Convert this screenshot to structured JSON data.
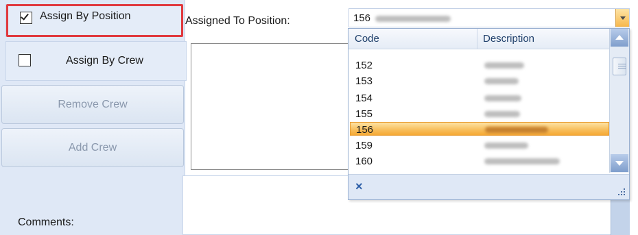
{
  "assign_by_position": {
    "label": "Assign By Position",
    "checked": true
  },
  "assign_by_crew": {
    "label": "Assign By Crew",
    "checked": false
  },
  "buttons": {
    "remove_crew": "Remove Crew",
    "add_crew": "Add Crew"
  },
  "assigned_to_position": {
    "label": "Assigned To Position:",
    "value": "156"
  },
  "comments": {
    "label": "Comments:"
  },
  "dropdown": {
    "columns": [
      "Code",
      "Description"
    ],
    "rows": [
      {
        "code": "152",
        "selected": false
      },
      {
        "code": "153",
        "selected": false
      },
      {
        "code": "154",
        "selected": false
      },
      {
        "code": "155",
        "selected": false
      },
      {
        "code": "156",
        "selected": true
      },
      {
        "code": "159",
        "selected": false
      },
      {
        "code": "160",
        "selected": false
      }
    ],
    "close_icon": "×"
  },
  "colors": {
    "highlight": "#e0393e",
    "selection": "#f8c05f",
    "panel": "#dfe8f6"
  }
}
